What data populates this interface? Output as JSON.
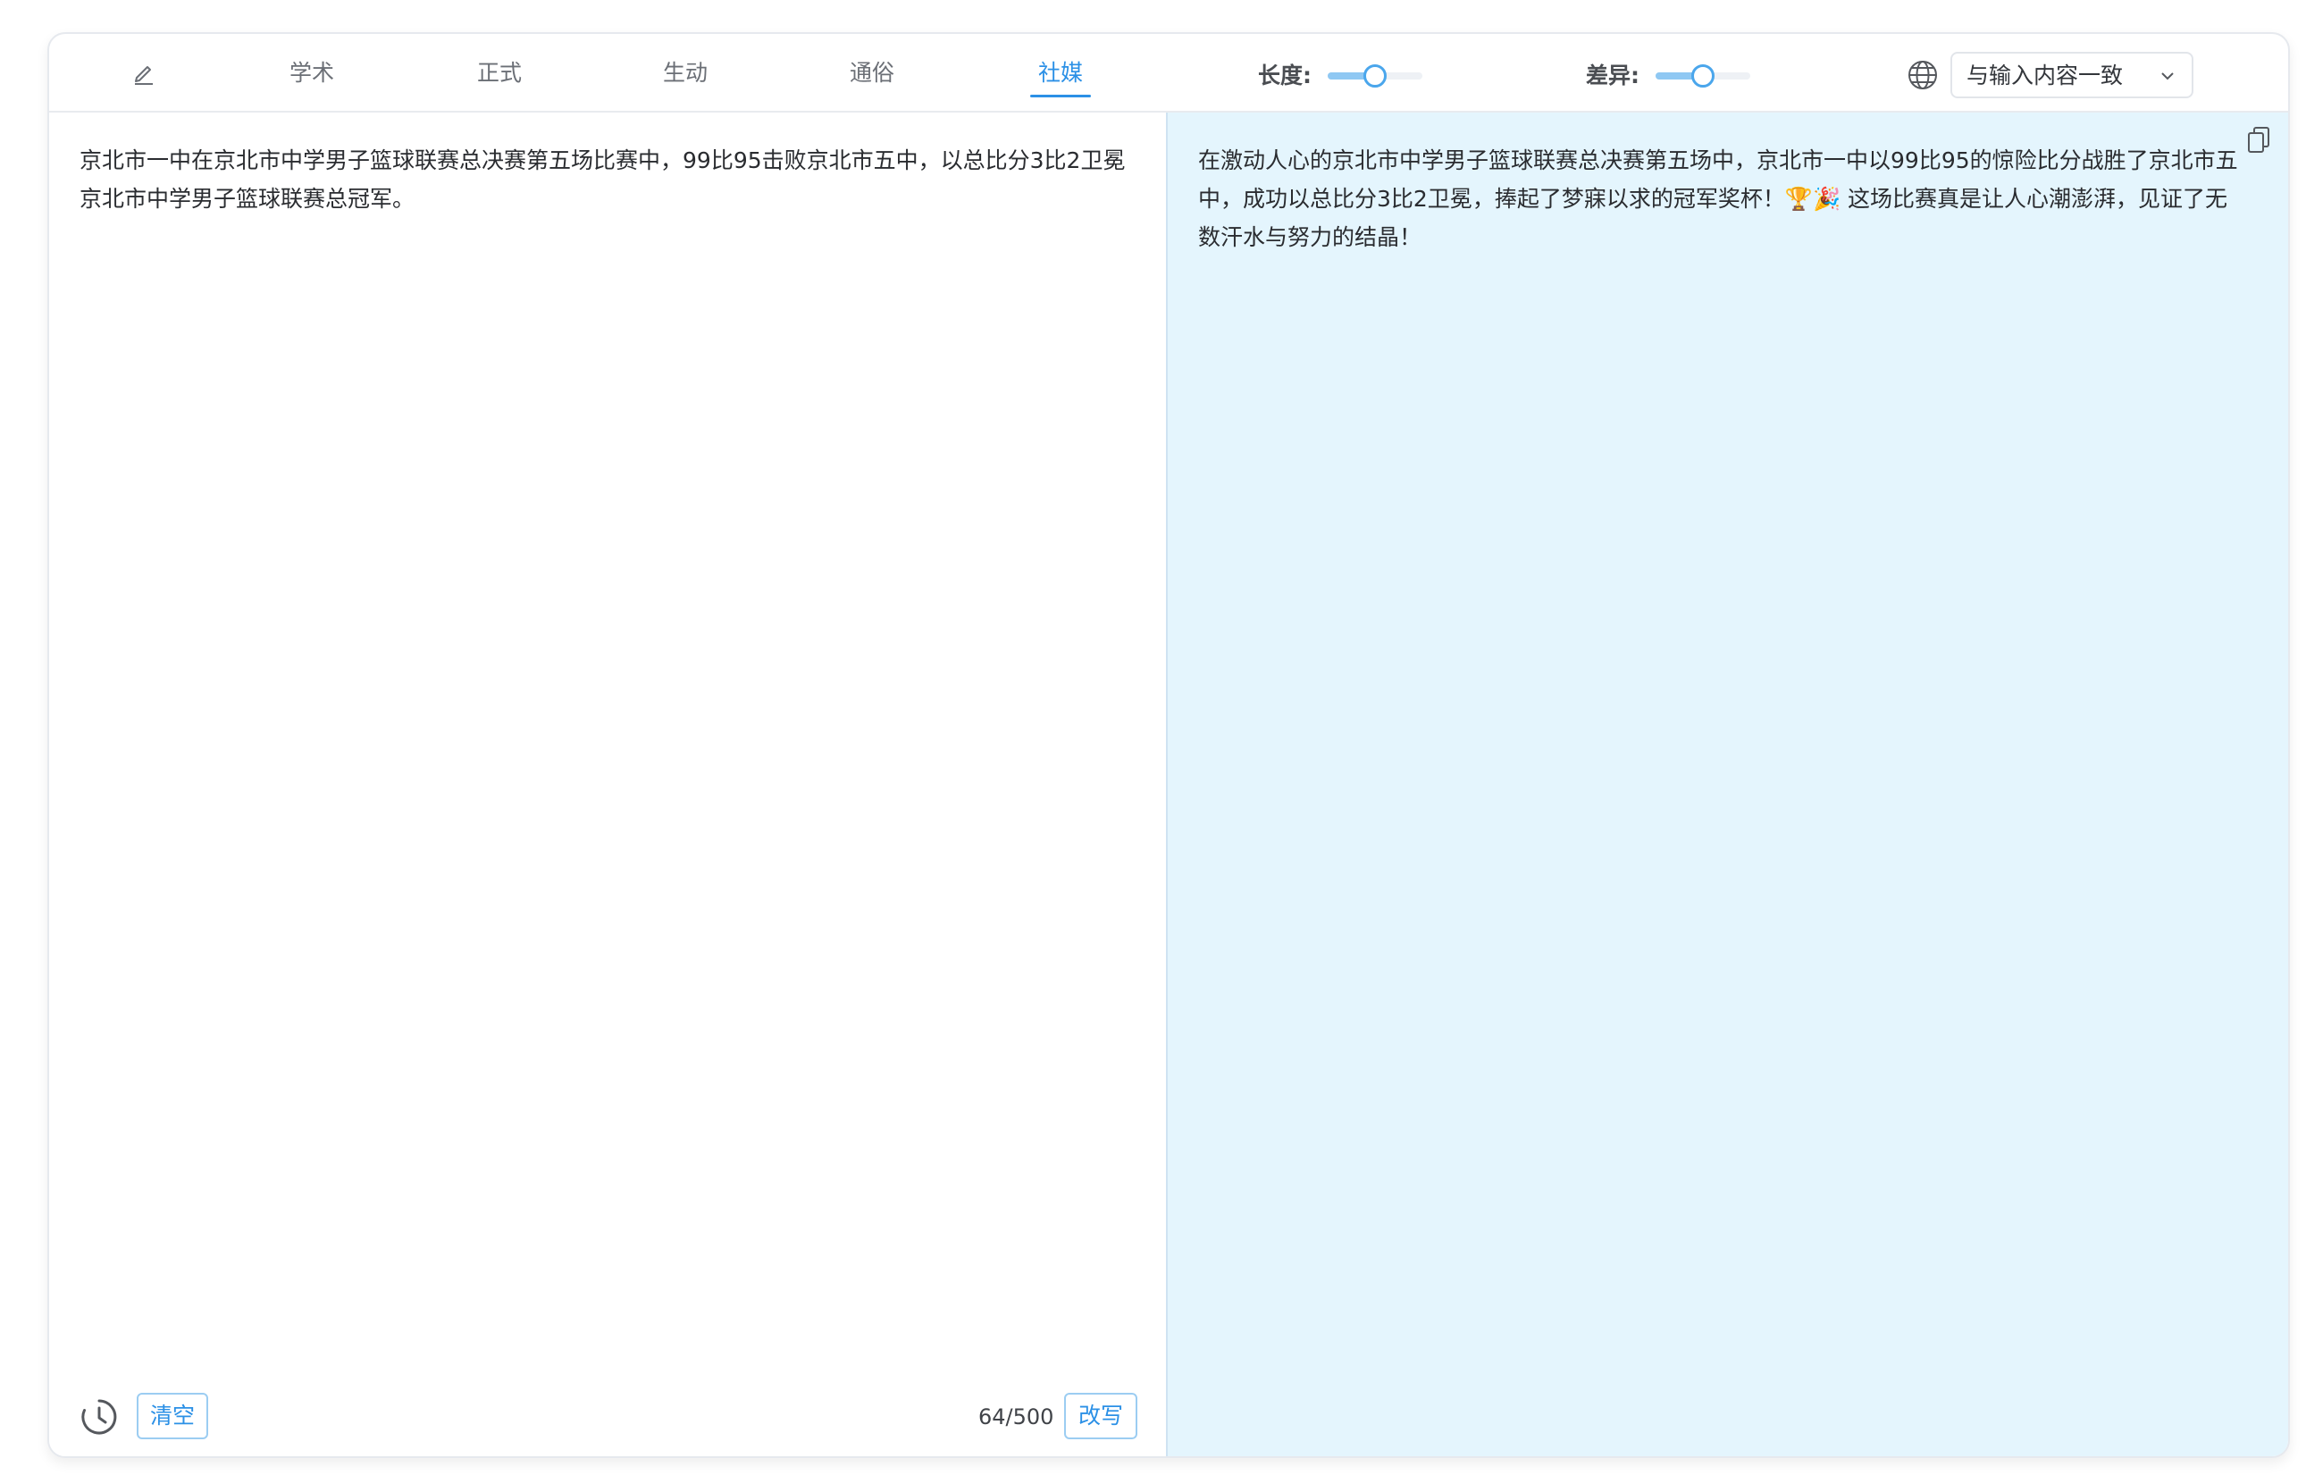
{
  "toolbar": {
    "tabs": [
      {
        "label": "学术"
      },
      {
        "label": "正式"
      },
      {
        "label": "生动"
      },
      {
        "label": "通俗"
      },
      {
        "label": "社媒"
      }
    ],
    "active_tab": "社媒",
    "length_label": "长度:",
    "length_level": 0.5,
    "diff_label": "差异:",
    "diff_level": 0.5,
    "language_select_value": "与输入内容一致"
  },
  "input": {
    "text": "京北市一中在京北市中学男子篮球联赛总决赛第五场比赛中，99比95击败京北市五中，以总比分3比2卫冕京北市中学男子篮球联赛总冠军。",
    "count": "64/500",
    "clear_label": "清空",
    "rewrite_label": "改写"
  },
  "output": {
    "text": "在激动人心的京北市中学男子篮球联赛总决赛第五场中，京北市一中以99比95的惊险比分战胜了京北市五中，成功以总比分3比2卫冕，捧起了梦寐以求的冠军奖杯！🏆🎉 这场比赛真是让人心潮澎湃，见证了无数汗水与努力的结晶！"
  },
  "colors": {
    "accent": "#2b90e6",
    "output_bg": "#e4f5fd",
    "slider_fill": "#8fc8f3"
  },
  "icons": [
    "pencil-icon",
    "globe-icon",
    "chevron-down-icon",
    "copy-icon",
    "history-icon"
  ]
}
